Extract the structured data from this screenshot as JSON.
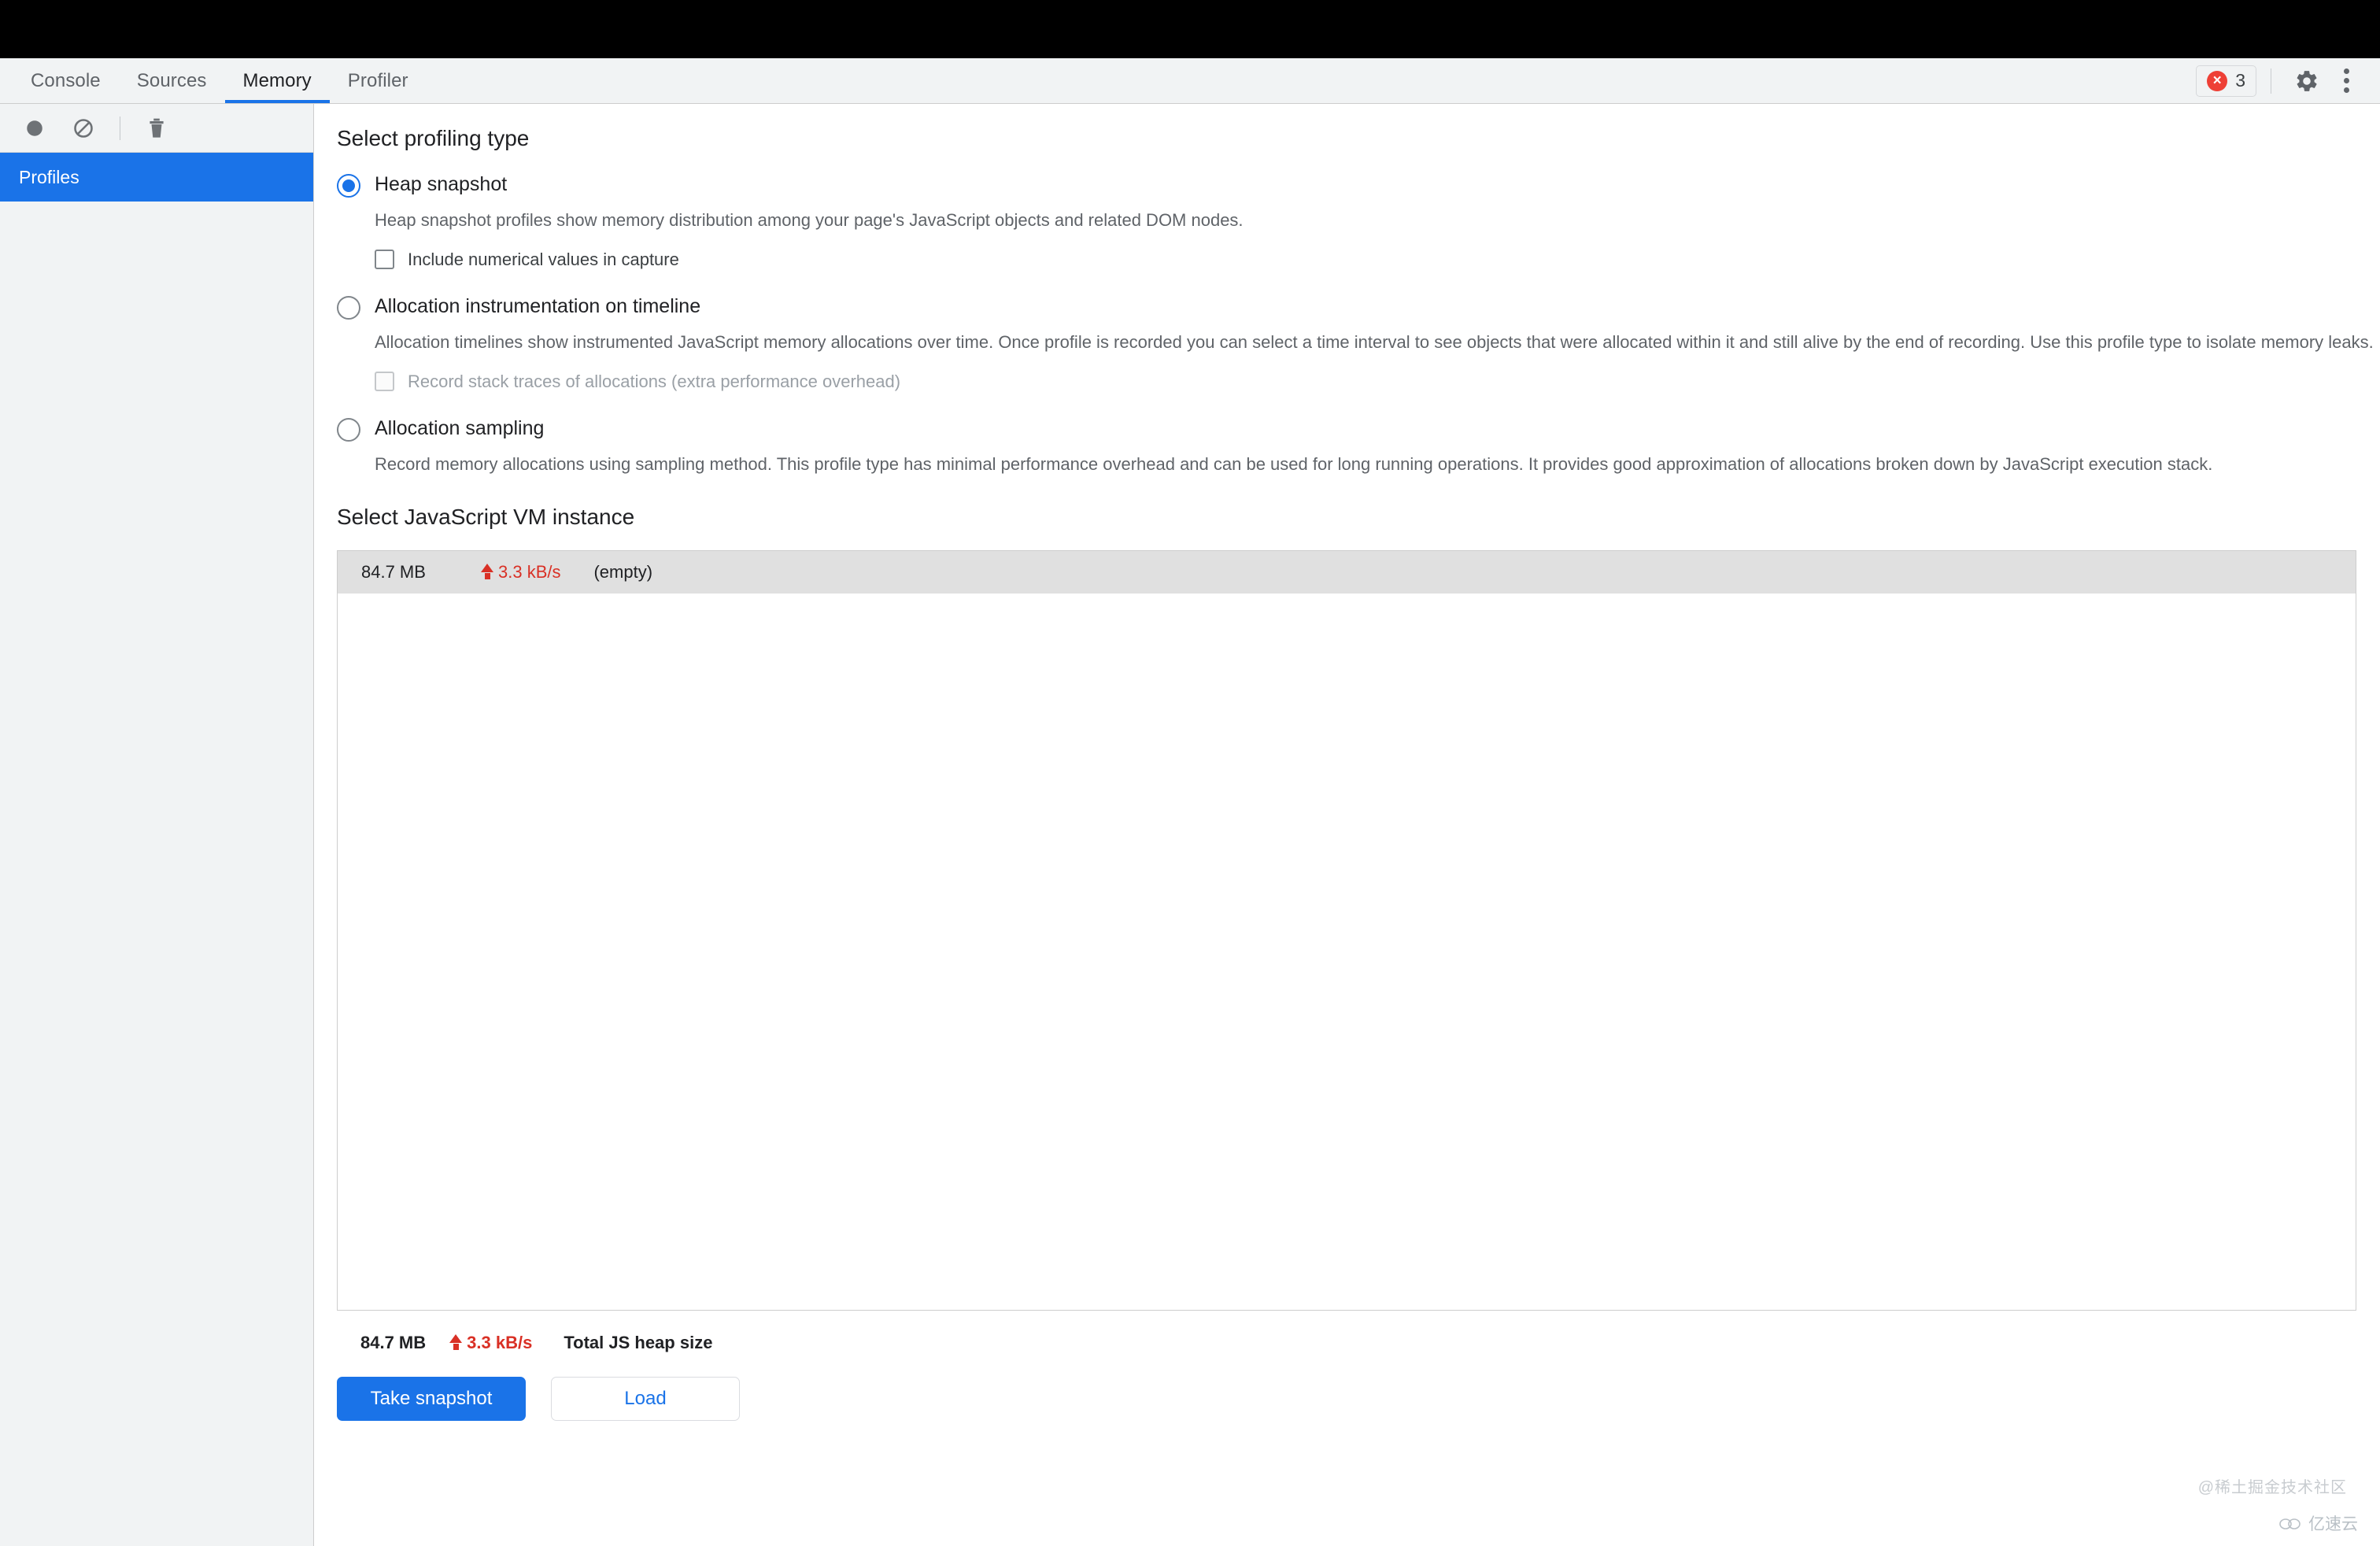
{
  "window": {
    "chrome_strip_color": "#000000"
  },
  "tabbar": {
    "tabs": [
      {
        "label": "Console",
        "active": false
      },
      {
        "label": "Sources",
        "active": false
      },
      {
        "label": "Memory",
        "active": true
      },
      {
        "label": "Profiler",
        "active": false
      }
    ],
    "error_badge": {
      "icon": "error-circle-icon",
      "mark": "×",
      "count": "3"
    },
    "settings_icon": "gear-icon",
    "more_icon": "kebab-menu-icon",
    "active_accent": "#1a73e8"
  },
  "sidebar": {
    "toolbar": {
      "record_icon": "record-circle-icon",
      "clear_icon": "no-entry-icon",
      "delete_icon": "trash-icon"
    },
    "items": [
      {
        "label": "Profiles",
        "selected": true
      }
    ],
    "selected_color": "#1a73e8"
  },
  "main": {
    "profiling_section_title": "Select profiling type",
    "options": [
      {
        "label": "Heap snapshot",
        "checked": true,
        "description": "Heap snapshot profiles show memory distribution among your page's JavaScript objects and related DOM nodes.",
        "checkbox": {
          "label": "Include numerical values in capture",
          "checked": false,
          "disabled": false
        }
      },
      {
        "label": "Allocation instrumentation on timeline",
        "checked": false,
        "description": "Allocation timelines show instrumented JavaScript memory allocations over time. Once profile is recorded you can select a time interval to see objects that were allocated within it and still alive by the end of recording. Use this profile type to isolate memory leaks.",
        "checkbox": {
          "label": "Record stack traces of allocations (extra performance overhead)",
          "checked": false,
          "disabled": true
        }
      },
      {
        "label": "Allocation sampling",
        "checked": false,
        "description": "Record memory allocations using sampling method. This profile type has minimal performance overhead and can be used for long running operations. It provides good approximation of allocations broken down by JavaScript execution stack.",
        "checkbox": null
      }
    ],
    "vm_section_title": "Select JavaScript VM instance",
    "vm_instances": [
      {
        "size": "84.7 MB",
        "rate": "3.3 kB/s",
        "name": "(empty)",
        "selected": true
      }
    ],
    "footer_status": {
      "size": "84.7 MB",
      "rate": "3.3 kB/s",
      "label": "Total JS heap size",
      "rate_color": "#d93025"
    },
    "buttons": {
      "take_snapshot": "Take snapshot",
      "load": "Load"
    }
  },
  "watermarks": {
    "community": "@稀土掘金技术社区",
    "brand": "亿速云",
    "brand_icon": "cloud-icon"
  }
}
